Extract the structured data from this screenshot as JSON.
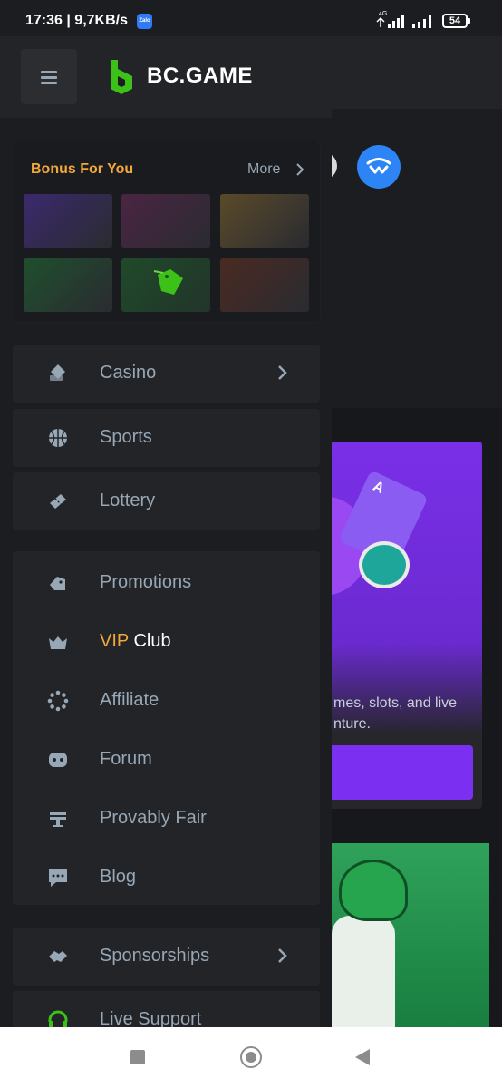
{
  "status_bar": {
    "time": "17:36",
    "speed": "9,7KB/s",
    "zalo": "Zalo",
    "network": "4G",
    "battery": "54"
  },
  "background": {
    "text_line1": "mes, slots, and live",
    "text_line2": "nture."
  },
  "drawer": {
    "logo_text": "BC.GAME",
    "bonus": {
      "title": "Bonus For You",
      "more_label": "More",
      "tile_colors": [
        "#3b2a6e",
        "#4a2543",
        "#5a4a2a",
        "#1f4f2e",
        "#1f4a2a",
        "#4a2a22"
      ]
    },
    "group_main": [
      {
        "label": "Casino",
        "icon": "casino-icon",
        "has_chevron": true
      },
      {
        "label": "Sports",
        "icon": "basketball-icon",
        "has_chevron": false
      },
      {
        "label": "Lottery",
        "icon": "lottery-ticket-icon",
        "has_chevron": false
      }
    ],
    "group_secondary": {
      "promotions": "Promotions",
      "vip_part1": "VIP",
      "vip_part2": "Club",
      "affiliate": "Affiliate",
      "forum": "Forum",
      "provably_fair": "Provably Fair",
      "blog": "Blog"
    },
    "sponsorships": "Sponsorships",
    "live_support": "Live Support"
  },
  "colors": {
    "accent_yellow": "#f0a73b",
    "brand_green": "#3bc117",
    "drawer_bg": "#1c1d20",
    "item_bg": "#232428"
  }
}
